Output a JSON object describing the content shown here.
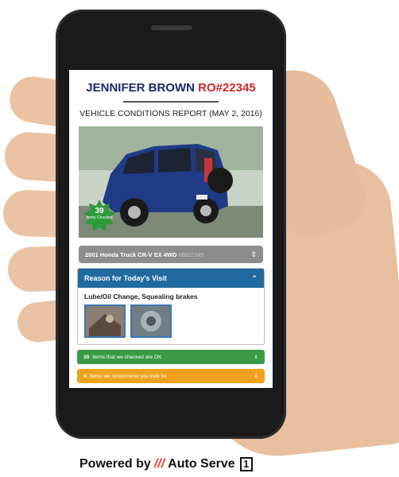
{
  "header": {
    "customer_name": "JENNIFER BROWN",
    "ro_number": "RO#22345",
    "report_title": "VEHICLE CONDITIONS REPORT (MAY 2, 2016)"
  },
  "photo": {
    "badge": {
      "count": "39",
      "label": "Items Checked"
    }
  },
  "vehicle": {
    "label": "2001 Honda Truck CR-V EX 4WD",
    "vin_suffix": "#BG2345"
  },
  "reason": {
    "title": "Reason for Today's Visit",
    "text": "Lube/Oil Change, Squealing brakes"
  },
  "status": {
    "checked": {
      "count": "39",
      "text": "Items that we checked are OK"
    },
    "recommended": {
      "count": "4",
      "text": "Items we recommend you look for"
    }
  },
  "footer": {
    "powered_by": "Powered by",
    "brand": "Auto Serve",
    "brand_num": "1"
  },
  "colors": {
    "name_blue": "#1b2a6b",
    "ro_red": "#d0272a",
    "reason_blue": "#1f6aa0",
    "status_green": "#3a9a43",
    "status_orange": "#f0a21f",
    "brand_red": "#e53d2a"
  }
}
